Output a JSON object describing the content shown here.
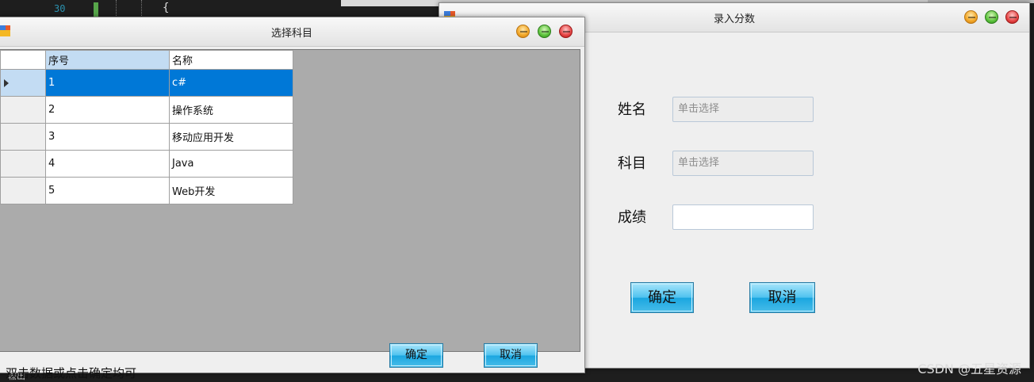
{
  "editor": {
    "line_number": "30",
    "brace": "{",
    "output_label": "输出"
  },
  "score_window": {
    "title": "录入分数",
    "name_label": "姓名",
    "name_placeholder": "单击选择",
    "subject_label": "科目",
    "subject_placeholder": "单击选择",
    "score_label": "成绩",
    "score_value": "",
    "ok_label": "确定",
    "cancel_label": "取消"
  },
  "subject_window": {
    "title": "选择科目",
    "columns": [
      "序号",
      "名称"
    ],
    "rows": [
      {
        "id": "1",
        "name": "c#",
        "selected": true
      },
      {
        "id": "2",
        "name": "操作系统",
        "selected": false
      },
      {
        "id": "3",
        "name": "移动应用开发",
        "selected": false
      },
      {
        "id": "4",
        "name": "Java",
        "selected": false
      },
      {
        "id": "5",
        "name": "Web开发",
        "selected": false
      }
    ],
    "hint": "双击数据或点击确定均可",
    "ok_label": "确定",
    "cancel_label": "取消"
  },
  "watermark": "CSDN @五星资源",
  "colors": {
    "selection": "#0078d7",
    "header_selected": "#c3dcf3",
    "button": "#1aa6e0"
  }
}
